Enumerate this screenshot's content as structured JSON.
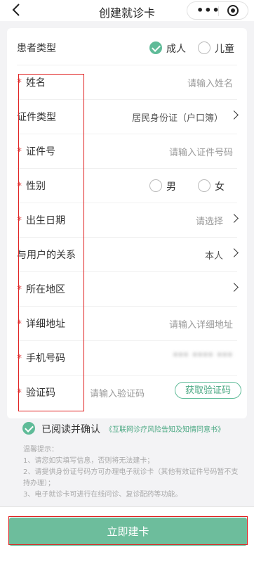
{
  "nav": {
    "title": "创建就诊卡",
    "more": "•••"
  },
  "patient_type": {
    "label": "患者类型",
    "adult": "成人",
    "child": "儿童",
    "selected": "成人"
  },
  "fields": {
    "name": {
      "required": "*",
      "label": "姓名",
      "placeholder": "请输入姓名"
    },
    "id_type": {
      "label": "证件类型",
      "value": "居民身份证（户口簿）"
    },
    "id_number": {
      "required": "*",
      "label": "证件号",
      "placeholder": "请输入证件号码"
    },
    "gender": {
      "required": "*",
      "label": "性别",
      "male": "男",
      "female": "女"
    },
    "birthdate": {
      "required": "*",
      "label": "出生日期",
      "placeholder": "请选择"
    },
    "relation": {
      "label": "与用户的关系",
      "value": "本人"
    },
    "region": {
      "required": "*",
      "label": "所在地区"
    },
    "address": {
      "required": "*",
      "label": "详细地址",
      "placeholder": "请输入详细地址"
    },
    "phone": {
      "required": "*",
      "label": "手机号码",
      "value": "*** **** ***"
    },
    "code": {
      "required": "*",
      "label": "验证码",
      "placeholder": "请输入验证码",
      "button": "获取验证码"
    }
  },
  "agreement": {
    "text": "已阅读并确认",
    "link": "《互联网诊疗风险告知及知情同意书》",
    "checked": true
  },
  "tips": {
    "title": "温馨提示：",
    "items": [
      "1、请您如实填写信息，否则将无法建卡；",
      "2、请提供身份证号码方可办理电子就诊卡（其他有效证件号码暂不支持办理）；",
      "3、电子就诊卡可进行在线问诊、复诊配药等功能。"
    ]
  },
  "submit": "立即建卡",
  "colors": {
    "accent": "#5fbb98",
    "required": "#e04646",
    "highlight_box": "#e02020"
  }
}
